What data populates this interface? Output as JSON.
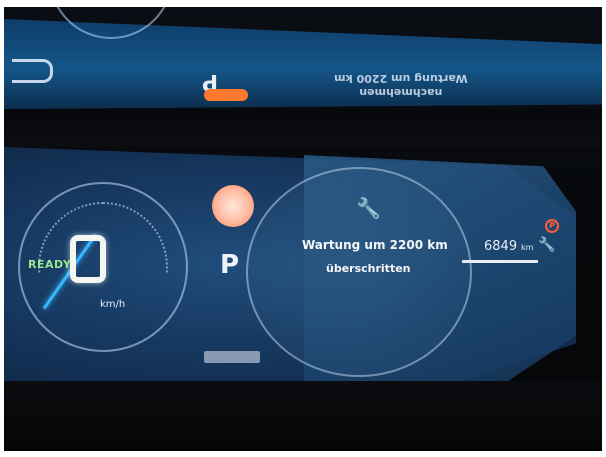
{
  "reflection": {
    "line1": "nachmehmen",
    "line2": "Wartung um 2200 km"
  },
  "gauge": {
    "status": "READY",
    "unit": "km/h"
  },
  "gear": "P",
  "service": {
    "line1": "Wartung um 2200 km",
    "line2": "überschritten"
  },
  "odometer": {
    "value": "6849",
    "unit": "km"
  },
  "icons": {
    "wrench": "wrench-icon",
    "parking_warning": "parking-brake-icon",
    "lamp": "warning-lamp-icon"
  },
  "colors": {
    "ready_green": "#9be58a",
    "needle_blue": "#39b6ff",
    "warning_orange": "#ff5a3a"
  }
}
